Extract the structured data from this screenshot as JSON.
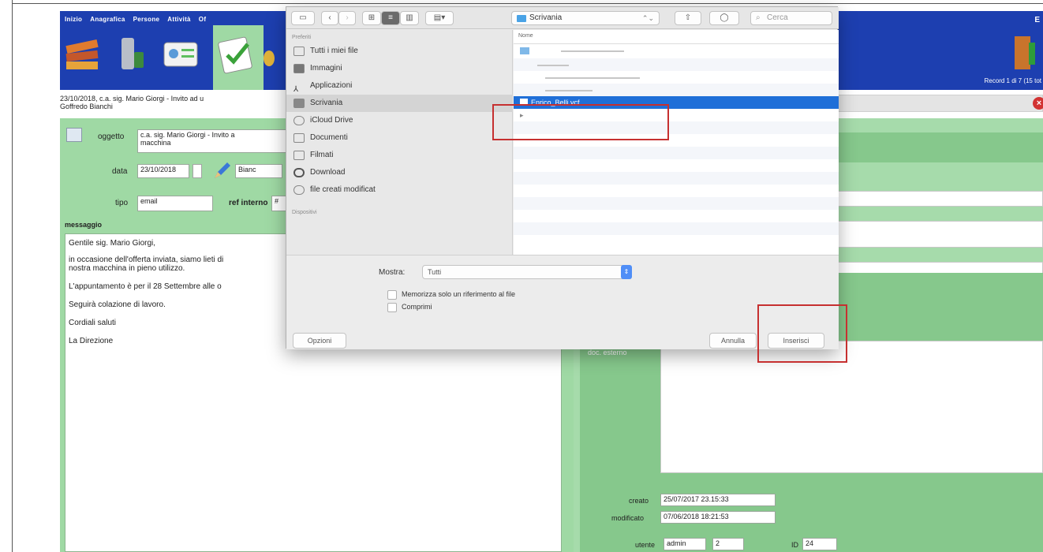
{
  "app": {
    "nav": [
      "Inizio",
      "Anagrafica",
      "Persone",
      "Attività",
      "Of"
    ],
    "right_letter": "E",
    "record_text": "Record 1 di 7 (15 tot",
    "subtitle": "23/10/2018, c.a. sig. Mario Giorgi - Invito ad u\nGoffredo Bianchi"
  },
  "form": {
    "oggetto_label": "oggetto",
    "oggetto_value": "c.a. sig. Mario Giorgi - Invito a\nmacchina",
    "data_label": "data",
    "data_value": "23/10/2018",
    "person_value": "Bianc",
    "tipo_label": "tipo",
    "tipo_value": "email",
    "ref_label": "ref interno",
    "ref_value": "#",
    "messaggio_label": "messaggio",
    "message_lines": [
      "Gentile sig. Mario Giorgi,",
      "in occasione dell'offerta inviata, siamo lieti di\nnostra macchina in pieno utilizzo.",
      "L'appuntamento è per il 28 Settembre alle o",
      "Seguirà colazione di lavoro.",
      "Cordiali saluti",
      "La Direzione"
    ]
  },
  "right_form": {
    "doc_label": "doc. esterno",
    "creato_label": "creato",
    "creato_value": "25/07/2017 23.15:33",
    "modificato_label": "modificato",
    "modificato_value": "07/06/2018 18:21:53",
    "utente_label": "utente",
    "utente_value": "admin",
    "utente_num": "2",
    "id_label": "ID",
    "id_value": "24"
  },
  "dialog": {
    "location": "Scrivania",
    "search_placeholder": "Cerca",
    "sidebar_header_favorites": "Preferiti",
    "sidebar_header_devices": "Dispositivi",
    "sidebar_items": [
      {
        "label": "Tutti i miei file",
        "icon": "all-files-icon"
      },
      {
        "label": "Immagini",
        "icon": "images-icon"
      },
      {
        "label": "Applicazioni",
        "icon": "applications-icon"
      },
      {
        "label": "Scrivania",
        "icon": "desktop-icon",
        "selected": true
      },
      {
        "label": "iCloud Drive",
        "icon": "cloud-icon"
      },
      {
        "label": "Documenti",
        "icon": "documents-icon"
      },
      {
        "label": "Filmati",
        "icon": "movies-icon"
      },
      {
        "label": "Download",
        "icon": "download-icon"
      },
      {
        "label": "file creati modificat",
        "icon": "gear-icon"
      }
    ],
    "list_header": "Nome",
    "selected_file": "Enrico_Belli.vcf",
    "mostra_label": "Mostra:",
    "mostra_value": "Tutti",
    "check1_label": "Memorizza solo un riferimento al file",
    "check2_label": "Comprimi",
    "options_button": "Opzioni",
    "cancel_button": "Annulla",
    "insert_button": "Inserisci"
  }
}
